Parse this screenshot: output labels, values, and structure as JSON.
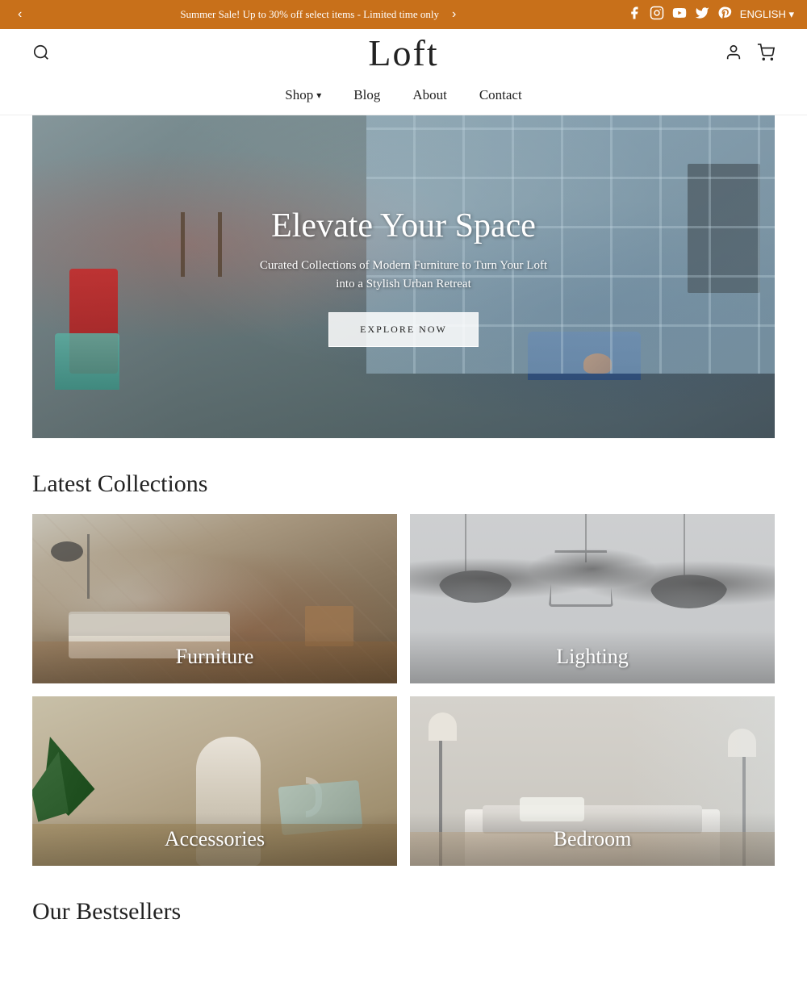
{
  "announcement": {
    "text": "Summer Sale! Up to 30% off select items - Limited time only",
    "prev_label": "‹",
    "next_label": "›",
    "lang": "ENGLISH ▾"
  },
  "social": {
    "icons": [
      "facebook",
      "instagram",
      "youtube",
      "twitter",
      "pinterest"
    ]
  },
  "header": {
    "logo": "Loft",
    "search_aria": "Search",
    "account_aria": "Account",
    "cart_aria": "Cart"
  },
  "nav": {
    "items": [
      {
        "label": "Shop",
        "has_dropdown": true
      },
      {
        "label": "Blog",
        "has_dropdown": false
      },
      {
        "label": "About",
        "has_dropdown": false
      },
      {
        "label": "Contact",
        "has_dropdown": false
      }
    ]
  },
  "hero": {
    "title": "Elevate Your Space",
    "subtitle": "Curated Collections of Modern Furniture to Turn Your Loft into a Stylish Urban Retreat",
    "cta_label": "EXPLORE NOW"
  },
  "latest_collections": {
    "section_title": "Latest Collections",
    "items": [
      {
        "label": "Furniture",
        "bg_class": "bg-furniture"
      },
      {
        "label": "Lighting",
        "bg_class": "bg-lighting"
      },
      {
        "label": "Accessories",
        "bg_class": "bg-accessories"
      },
      {
        "label": "Bedroom",
        "bg_class": "bg-bedroom"
      }
    ]
  },
  "bestsellers": {
    "section_title": "Our Bestsellers"
  }
}
